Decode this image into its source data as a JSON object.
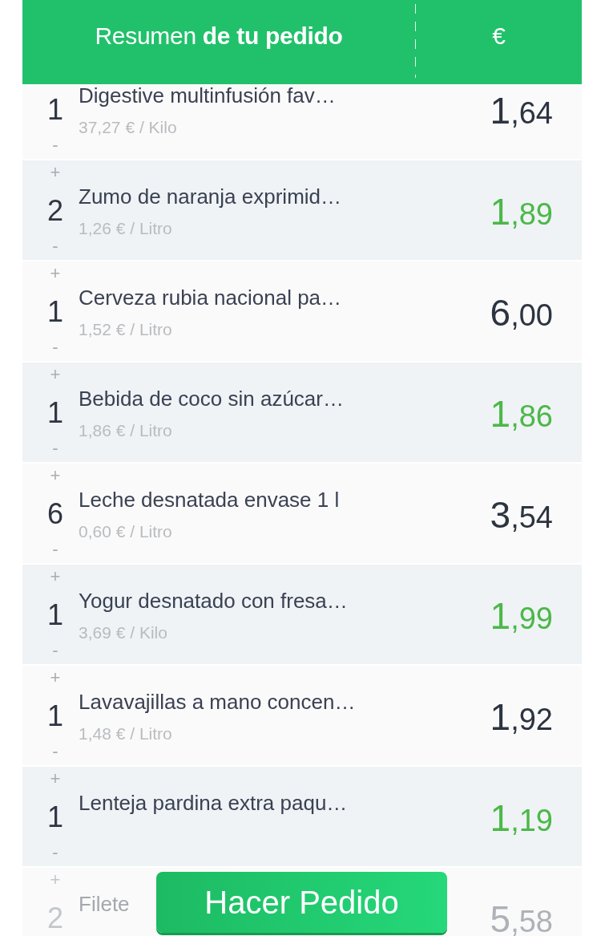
{
  "header": {
    "title": "Resumen **de tu pedido**",
    "currency": "€"
  },
  "rows": [
    {
      "quantity": "1",
      "minus": "-",
      "name": "Digestive multinfusión fav…",
      "unit_price": "37,27 € / Kilo",
      "price": "1,64",
      "faded": false
    },
    {
      "plus": "+",
      "quantity": "2",
      "minus": "-",
      "name": "Zumo de naranja exprimid…",
      "unit_price": "1,26 € / Litro",
      "price": "1,89",
      "faded": false
    },
    {
      "plus": "+",
      "quantity": "1",
      "minus": "-",
      "name": "Cerveza rubia nacional pa…",
      "unit_price": "1,52 € / Litro",
      "price": "6,00",
      "faded": false
    },
    {
      "plus": "+",
      "quantity": "1",
      "minus": "-",
      "name": "Bebida de coco sin azúcar…",
      "unit_price": "1,86 € / Litro",
      "price": "1,86",
      "faded": false
    },
    {
      "plus": "+",
      "quantity": "6",
      "minus": "-",
      "name": "Leche desnatada envase 1 l",
      "unit_price": "0,60 € / Litro",
      "price": "3,54",
      "faded": false
    },
    {
      "plus": "+",
      "quantity": "1",
      "minus": "-",
      "name": "Yogur desnatado con fresa…",
      "unit_price": "3,69 € / Kilo",
      "price": "1,99",
      "faded": false
    },
    {
      "plus": "+",
      "quantity": "1",
      "minus": "-",
      "name": "Lavavajillas a mano concen…",
      "unit_price": "1,48 € / Litro",
      "price": "1,92",
      "faded": false
    },
    {
      "plus": "+",
      "quantity": "1",
      "minus": "-",
      "name": "Lenteja pardina extra paqu…",
      "price": "1,19",
      "faded": false
    },
    {
      "plus": "+",
      "quantity": "2",
      "name": "Filete",
      "price": "5,58",
      "faded": true
    }
  ],
  "order_button": "Hacer Pedido"
}
